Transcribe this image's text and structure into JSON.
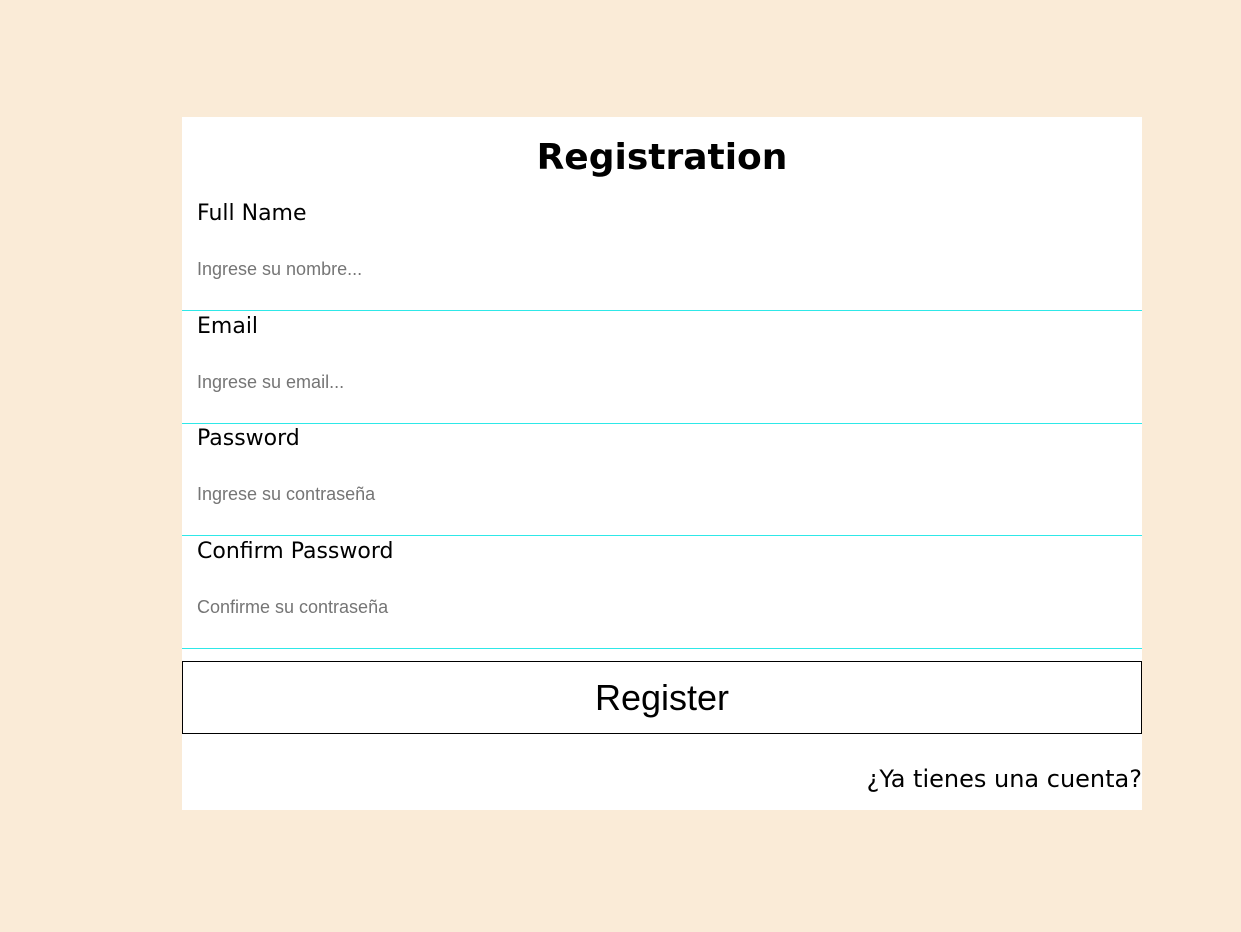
{
  "form": {
    "title": "Registration",
    "fields": [
      {
        "label": "Full Name",
        "placeholder": "Ingrese su nombre...",
        "value": ""
      },
      {
        "label": "Email",
        "placeholder": "Ingrese su email...",
        "value": ""
      },
      {
        "label": "Password",
        "placeholder": "Ingrese su contraseña",
        "value": ""
      },
      {
        "label": "Confirm Password",
        "placeholder": "Confirme su contraseña",
        "value": ""
      }
    ],
    "submit_label": "Register",
    "login_link": "¿Ya tienes una cuenta?"
  },
  "colors": {
    "page_background": "#faebd7",
    "card_background": "#ffffff",
    "field_underline": "#2ee8e8",
    "placeholder_text": "#757575"
  }
}
